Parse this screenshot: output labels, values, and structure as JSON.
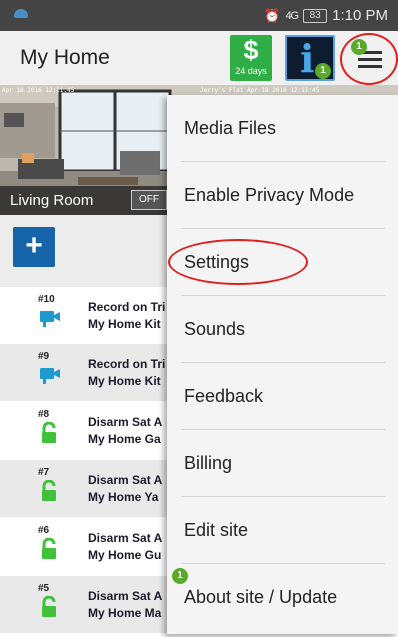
{
  "status_bar": {
    "alarm_icon": "alarm-clock-icon",
    "signal": "4G",
    "battery": "83",
    "time": "1:10 PM"
  },
  "header": {
    "title": "My Home",
    "billing": {
      "symbol": "$",
      "days_label": "24 days",
      "color": "#2eae45"
    },
    "info": {
      "symbol": "i",
      "badge": "1"
    },
    "menu": {
      "icon": "hamburger-menu-icon",
      "badge": "1"
    }
  },
  "camera": {
    "room_label": "Living Room",
    "off_label": "OFF"
  },
  "add_button": {
    "symbol": "+"
  },
  "events": [
    {
      "num": "#10",
      "icon": "video-camera-icon",
      "line1": "Record on Tri",
      "line2": "My Home Kit"
    },
    {
      "num": "#9",
      "icon": "video-camera-icon",
      "line1": "Record on Tri",
      "line2": "My Home Kit"
    },
    {
      "num": "#8",
      "icon": "unlocked-padlock-icon",
      "line1": "Disarm Sat A",
      "line2": "My Home Ga"
    },
    {
      "num": "#7",
      "icon": "unlocked-padlock-icon",
      "line1": "Disarm Sat A",
      "line2": "My Home Ya"
    },
    {
      "num": "#6",
      "icon": "unlocked-padlock-icon",
      "line1": "Disarm Sat A",
      "line2": "My Home Gu"
    },
    {
      "num": "#5",
      "icon": "unlocked-padlock-icon",
      "line1": "Disarm Sat A",
      "line2": "My Home Ma"
    }
  ],
  "menu": {
    "items": [
      {
        "label": "Media Files"
      },
      {
        "label": "Enable Privacy Mode"
      },
      {
        "label": "Settings"
      },
      {
        "label": "Sounds"
      },
      {
        "label": "Feedback"
      },
      {
        "label": "Billing"
      },
      {
        "label": "Edit site"
      },
      {
        "label": "About site / Update",
        "badge": "1"
      }
    ]
  },
  "colors": {
    "accent_blue": "#1563a8",
    "badge_green": "#5aaa2a",
    "highlight_red": "#e02020",
    "event_icon_blue": "#1e9ad0",
    "lock_green": "#3fc23a"
  }
}
